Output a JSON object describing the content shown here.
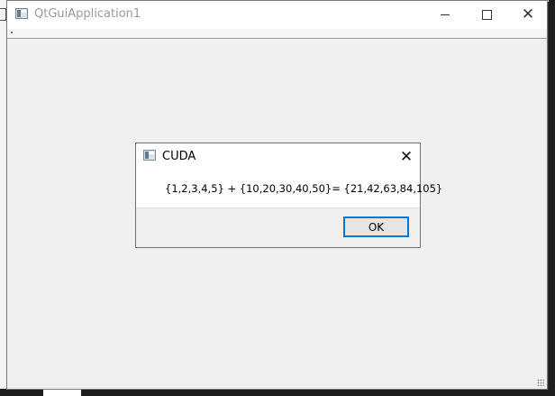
{
  "main_window": {
    "title": "QtGuiApplication1",
    "controls": {
      "minimize_icon": "minimize-icon",
      "maximize_icon": "maximize-icon",
      "close_icon": "close-icon"
    }
  },
  "dialog": {
    "title": "CUDA",
    "message": "{1,2,3,4,5} + {10,20,30,40,50}= {21,42,63,84,105}",
    "ok_label": "OK",
    "close_glyph": "✕"
  },
  "colors": {
    "accent_focus": "#0078d7",
    "window_bg": "#f0f0f0",
    "titlebar_bg": "#ffffff"
  }
}
